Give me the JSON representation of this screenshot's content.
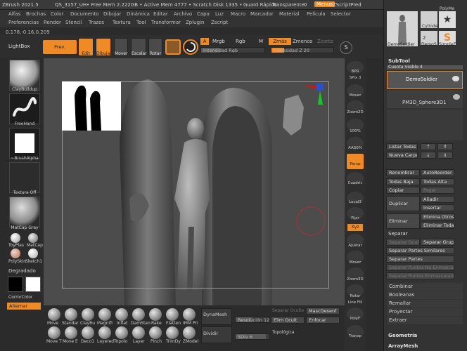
{
  "titlebar": {
    "app": "ZBrush 2021.5",
    "doc": "QS_3157_UH",
    "mem": "• Free Mem 2.222GB • Active Mem 4777 • Scratch Disk 1335 •",
    "save": "Guard Rápido",
    "transparent": "Transparente",
    "transparent_val": "0",
    "menus": "Menus",
    "script": "ZScriptPred"
  },
  "menu1": [
    "Alfas",
    "Brochas",
    "Color",
    "Documento",
    "Dibujar",
    "Dinámica",
    "Editar",
    "Archivo",
    "Capa",
    "Luz",
    "Macro",
    "Marcador",
    "Material",
    "Película",
    "Selector"
  ],
  "menu2": [
    "Preferencias",
    "Render",
    "Stencil",
    "Trazos",
    "Textura",
    "Tool",
    "Transformar",
    "Zplugin",
    "Zscript"
  ],
  "coords": "0.178,-0.16,0.209",
  "shelf": {
    "lightbox": "LightBox",
    "prev_boolean": "Prev. Booleano",
    "edit": "Edit",
    "draw": "Dibujar",
    "move": "Mover",
    "scale": "Escalar",
    "rotate": "Rotar",
    "a_label": "A",
    "mrgb": "Mrgb",
    "rgb": "Rgb",
    "m": "M",
    "zadd": "Zmás",
    "zsub": "Zmenos",
    "zcut": "Zcorte",
    "rgb_intensity": "Intensidad Rgb",
    "z_intensity": "Intensidad Z 20",
    "s_label": "S"
  },
  "leftshelf": {
    "brush": "ClayBuildup",
    "stroke": "FreeHand",
    "alpha": "~BrushAlpha",
    "texture": "Textura Off",
    "material": "MatCap Gray",
    "mat_a": "ToyPlas",
    "mat_b": "MatCap",
    "mat_c": "PolySkin",
    "mat_d": "Sketch1",
    "gradient": "Degradado",
    "switch_color": "CorrorColor",
    "alternate": "Alternar"
  },
  "navcol": [
    "BPR",
    "SPix 3",
    "Mover",
    "Zoom2D",
    "100%",
    "AAS0%",
    "Persp",
    "Cuadric",
    "Local3",
    "Tran",
    "Fijar",
    "Xyz",
    "Ajustar",
    "Mover",
    "Zoom3D",
    "Rotar",
    "Line Fill",
    "PolyF",
    "Transp"
  ],
  "rpanel": {
    "tool_a": "DemoSoldier",
    "tool_b": "DemoS",
    "tool_c": "SimpleE",
    "tool_d": "Cylinde",
    "tool_e": "PolyMe",
    "count": "2",
    "subtool": "SubTool",
    "visible": "Cuenta Visible 4",
    "sub1": "DemoSoldier",
    "sub2": "PM3D_Sphere3D1",
    "list_all": "Listar Todas",
    "new_folder": "Nueva Carpeta",
    "rename": "Renombrar",
    "autoreorder": "AutoReorder",
    "all_low": "Todas Baja",
    "all_high": "Todas Alta",
    "copy": "Copiar",
    "paste": "Pegar",
    "duplicate": "Duplicar",
    "append": "Añadir",
    "insert": "Insertar",
    "delete": "Eliminar",
    "del_other": "Elimina Otros",
    "del_all": "Eliminar Todas",
    "split": "Separar",
    "split_hidden": "Separar Oculto",
    "split_group": "Separar Grupo",
    "split_similar": "Separar Partes Similares",
    "split_parts": "Separar Partes",
    "split_unmasked": "Separar Puntos No Enmascar",
    "split_masked": "Separar Puntos Enmascarados",
    "merge": "Combinar",
    "boolean": "Booleanas",
    "remesh": "Remallar",
    "project": "Proyectar",
    "extract": "Extraer",
    "geometry": "Geometría",
    "arraymesh": "ArrayMesh"
  },
  "bottom": {
    "brushes_top": [
      "Move",
      "Standar",
      "ClayBu",
      "Magnifi",
      "Inflat",
      "DamStan",
      "Rake",
      "Flatten",
      "IMM Pri"
    ],
    "brushes_bot": [
      "Move T",
      "Move E",
      "Deco1",
      "Layered",
      "Topolo",
      "Layer",
      "Pinch",
      "TrimDy",
      "ZModel"
    ],
    "dynamesh": "DynaMesh",
    "divide": "Dividir",
    "resolution": "Resolución 128",
    "sdiv": "SDiv 6",
    "split_hidden": "Separar Oculto",
    "merge_down": "MascDesenf",
    "hide": "Elim Ocult",
    "focus": "Enfocar",
    "topology": "Topológica"
  },
  "colors": {
    "accent": "#f08a24",
    "canvas": "#4c4c4c",
    "ui": "#2b2b2b"
  }
}
